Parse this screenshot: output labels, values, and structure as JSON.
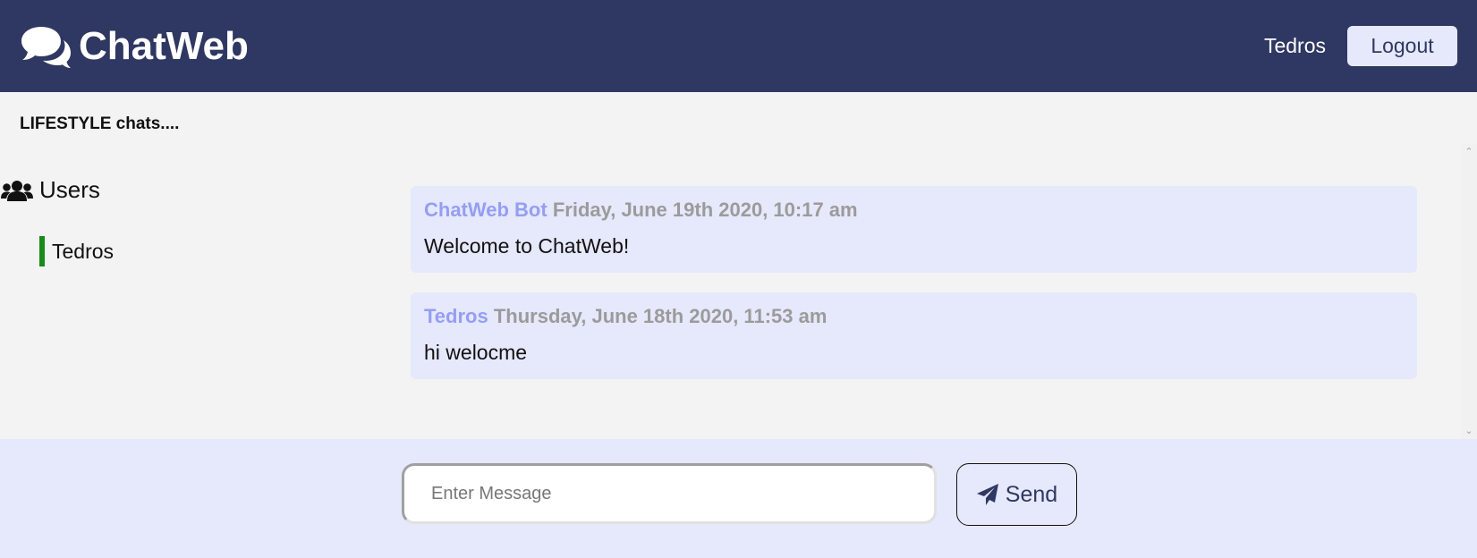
{
  "header": {
    "brand_icon": "comments-icon",
    "title": "ChatWeb",
    "username": "Tedros",
    "logout_label": "Logout"
  },
  "room": {
    "name": "LIFESTYLE chats...."
  },
  "sidebar": {
    "heading_icon": "users-icon",
    "heading": "Users",
    "users": [
      {
        "name": "Tedros",
        "status_color": "#1a8a1a"
      }
    ]
  },
  "messages": [
    {
      "author": "ChatWeb Bot",
      "time": "Friday, June 19th 2020, 10:17 am",
      "text": "Welcome to ChatWeb!"
    },
    {
      "author": "Tedros",
      "time": "Thursday, June 18th 2020, 11:53 am",
      "text": "hi welocme"
    }
  ],
  "composer": {
    "placeholder": "Enter Message",
    "value": "",
    "send_icon": "paper-plane-icon",
    "send_label": "Send"
  },
  "colors": {
    "header_bg": "#2f3862",
    "accent_light": "#e6e8fb",
    "author": "#949ef2",
    "timestamp": "#9b9b9b"
  }
}
